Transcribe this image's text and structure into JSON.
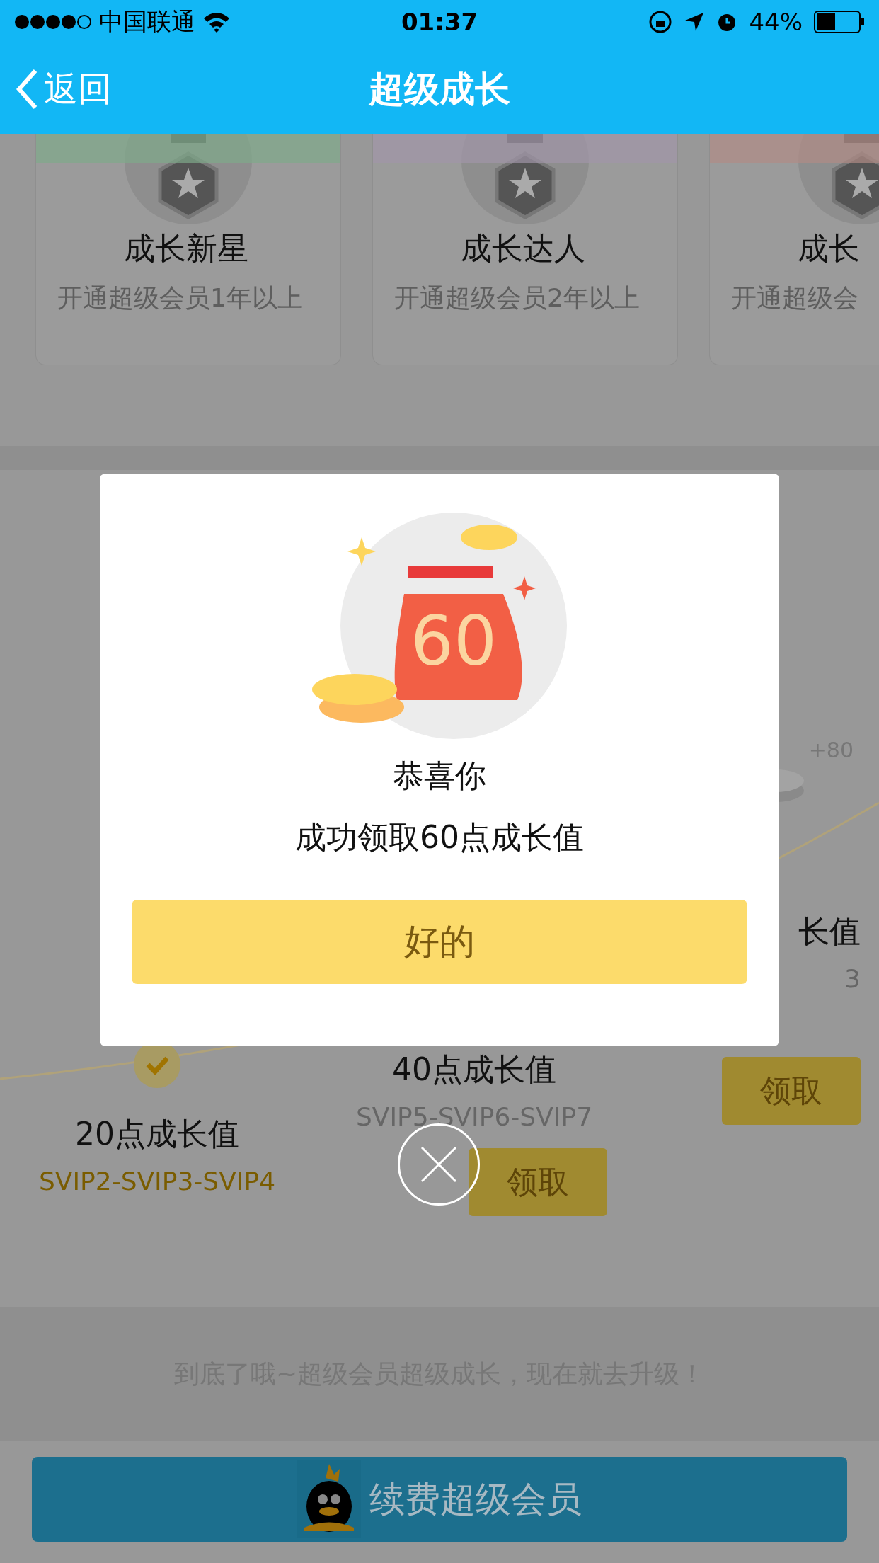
{
  "status_bar": {
    "carrier": "中国联通",
    "time": "01:37",
    "battery": "44%"
  },
  "nav": {
    "back": "返回",
    "title": "超级成长"
  },
  "badges": [
    {
      "title": "成长新星",
      "subtitle": "开通超级会员1年以上",
      "color": "#7fa98a"
    },
    {
      "title": "成长达人",
      "subtitle": "开通超级会员2年以上",
      "color": "#a196a8"
    },
    {
      "title": "成长",
      "subtitle": "开通超级会",
      "color": "#b08c86"
    }
  ],
  "rewards": [
    {
      "title": "20点成长值",
      "levels": "SVIP2-SVIP3-SVIP4",
      "claimed": true
    },
    {
      "title": "40点成长值",
      "levels": "SVIP5-SVIP6-SVIP7",
      "claimed": false,
      "button": "领取"
    },
    {
      "bonus": "+80",
      "title": "长值",
      "levels": "3",
      "claimed": false,
      "button": "领取"
    }
  ],
  "footer_note": "到底了哦~超级会员超级成长，现在就去升级！",
  "renew_button": "续费超级会员",
  "dialog": {
    "amount": "60",
    "title": "恭喜你",
    "message": "成功领取60点成长值",
    "confirm": "好的"
  }
}
